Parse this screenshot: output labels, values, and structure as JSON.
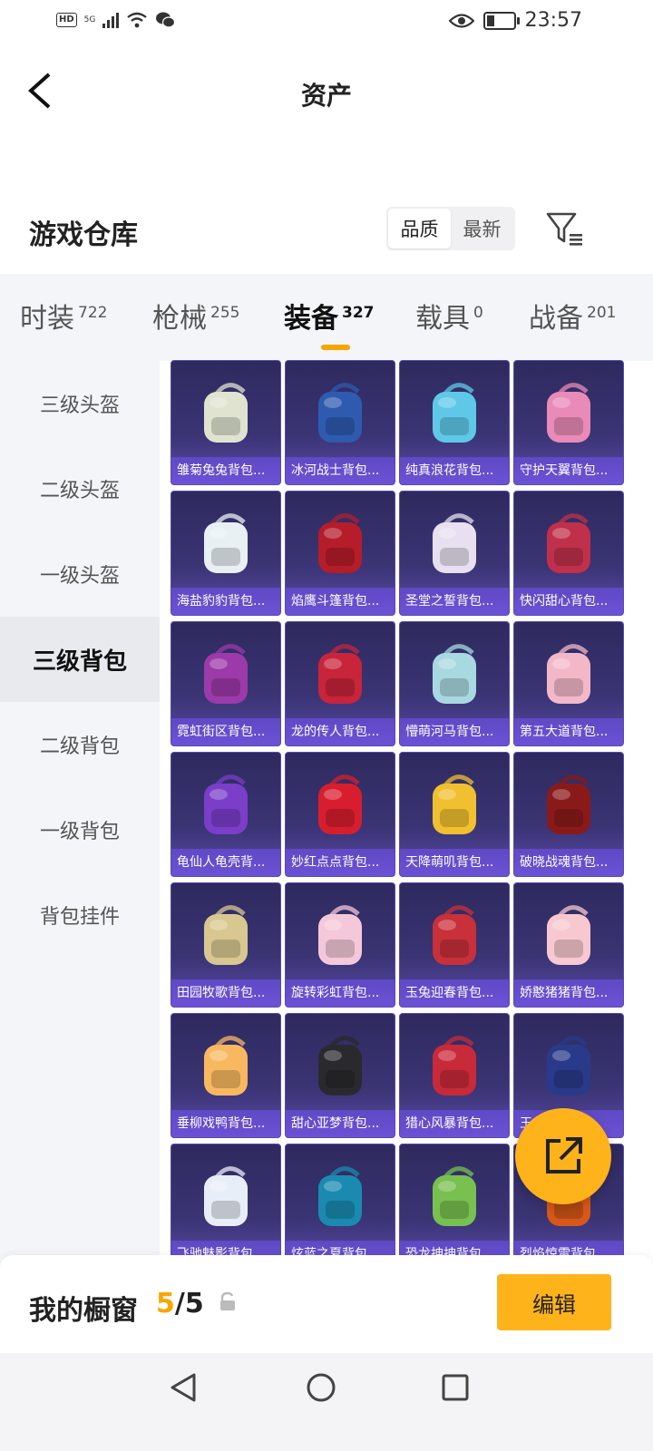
{
  "status_bar": {
    "hd": "HD",
    "network": "5G",
    "time": "23:57"
  },
  "header": {
    "title": "资产"
  },
  "warehouse": {
    "title": "游戏仓库",
    "sort_options": [
      "品质",
      "最新"
    ],
    "active_sort": "品质"
  },
  "tabs": [
    {
      "label": "时装",
      "count": "722",
      "active": false
    },
    {
      "label": "枪械",
      "count": "255",
      "active": false
    },
    {
      "label": "装备",
      "count": "327",
      "active": true
    },
    {
      "label": "载具",
      "count": "0",
      "active": false
    },
    {
      "label": "战备",
      "count": "201",
      "active": false
    }
  ],
  "sidebar": {
    "items": [
      {
        "label": "三级头盔",
        "active": false
      },
      {
        "label": "二级头盔",
        "active": false
      },
      {
        "label": "一级头盔",
        "active": false
      },
      {
        "label": "三级背包",
        "active": true
      },
      {
        "label": "二级背包",
        "active": false
      },
      {
        "label": "一级背包",
        "active": false
      },
      {
        "label": "背包挂件",
        "active": false
      }
    ]
  },
  "items": [
    {
      "name": "雏菊兔兔背包...",
      "color": "#dfe3d0"
    },
    {
      "name": "冰河战士背包...",
      "color": "#2e5bb0"
    },
    {
      "name": "纯真浪花背包...",
      "color": "#5fc8e8"
    },
    {
      "name": "守护天翼背包...",
      "color": "#e98ab8"
    },
    {
      "name": "海盐豹豹背包...",
      "color": "#e8f0f4"
    },
    {
      "name": "焰鹰斗篷背包...",
      "color": "#b51d2a"
    },
    {
      "name": "圣堂之誓背包...",
      "color": "#e8e0f0"
    },
    {
      "name": "快闪甜心背包...",
      "color": "#c0304a"
    },
    {
      "name": "霓虹街区背包...",
      "color": "#9b3aa8"
    },
    {
      "name": "龙的传人背包...",
      "color": "#c8243a"
    },
    {
      "name": "懵萌河马背包...",
      "color": "#a8d8e0"
    },
    {
      "name": "第五大道背包...",
      "color": "#f3b8c8"
    },
    {
      "name": "龟仙人龟壳背...",
      "color": "#7a3ec8"
    },
    {
      "name": "妙红点点背包...",
      "color": "#d81e2e"
    },
    {
      "name": "天降萌叽背包...",
      "color": "#f0c030"
    },
    {
      "name": "破晓战魂背包...",
      "color": "#8a1a1a"
    },
    {
      "name": "田园牧歌背包...",
      "color": "#d8c890"
    },
    {
      "name": "旋转彩虹背包...",
      "color": "#f4c8d8"
    },
    {
      "name": "玉兔迎春背包...",
      "color": "#c8303a"
    },
    {
      "name": "娇憨猪猪背包...",
      "color": "#f8c8d0"
    },
    {
      "name": "垂柳戏鸭背包...",
      "color": "#f8b860"
    },
    {
      "name": "甜心亚梦背包...",
      "color": "#2a2a2e"
    },
    {
      "name": "猎心风暴背包...",
      "color": "#c82a3a"
    },
    {
      "name": "王...背包...",
      "color": "#2a3a8a"
    },
    {
      "name": "飞驰魅影背包...",
      "color": "#e8eef8"
    },
    {
      "name": "炫蓝之夏背包...",
      "color": "#1a8ab0"
    },
    {
      "name": "恐龙抻抻背包...",
      "color": "#78c050"
    },
    {
      "name": "烈焰惊雷背包...",
      "color": "#d8581a"
    }
  ],
  "window": {
    "label": "我的橱窗",
    "current": "5",
    "separator": "/",
    "total": "5"
  },
  "edit_button": "编辑",
  "icons": {
    "back": "chevron-left-icon",
    "filter": "filter-icon",
    "share": "share-icon",
    "lock": "lock-icon"
  },
  "accent_color": "#f7a600"
}
